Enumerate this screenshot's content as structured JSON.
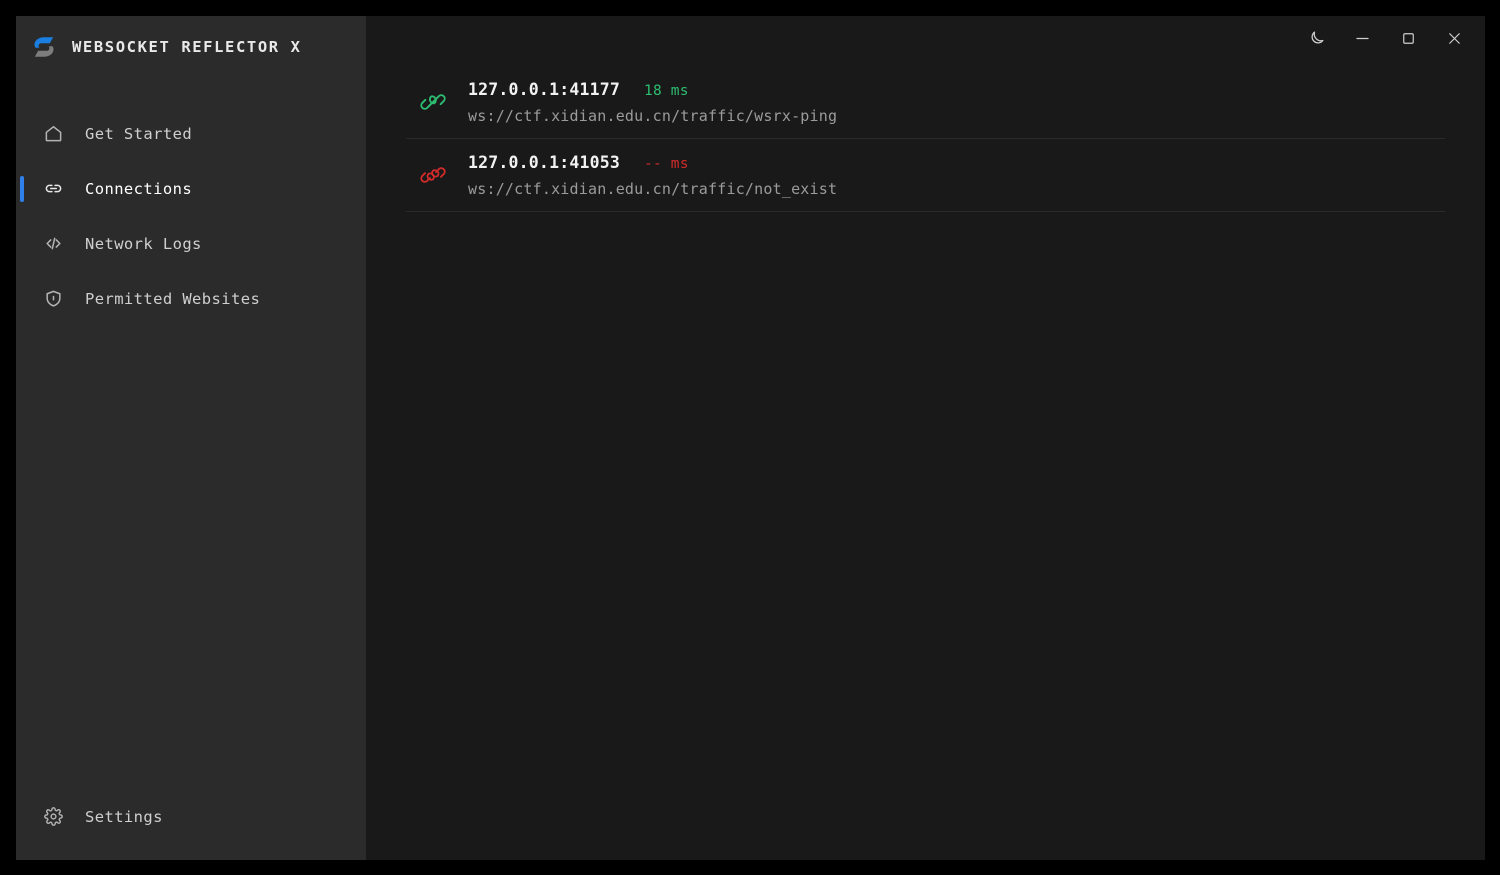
{
  "window": {
    "controls": [
      {
        "name": "theme-toggle",
        "icon": "moon-icon",
        "label": "Toggle dark mode"
      },
      {
        "name": "minimize",
        "icon": "minimize-icon",
        "label": "Minimize"
      },
      {
        "name": "maximize",
        "icon": "maximize-icon",
        "label": "Maximize"
      },
      {
        "name": "close",
        "icon": "close-icon",
        "label": "Close"
      }
    ]
  },
  "sidebar": {
    "brand": {
      "title": "WEBSOCKET REFLECTOR X",
      "logo_icon": "wsrx-hex-logo",
      "logo_colors": {
        "primary": "#1a7fe0",
        "secondary": "#7d7d7d"
      }
    },
    "items": [
      {
        "label": "Get Started",
        "icon": "home-icon",
        "active": false
      },
      {
        "label": "Connections",
        "icon": "link-icon",
        "active": true
      },
      {
        "label": "Network Logs",
        "icon": "code-icon",
        "active": false
      },
      {
        "label": "Permitted Websites",
        "icon": "shield-icon",
        "active": false
      }
    ],
    "bottom_items": [
      {
        "label": "Settings",
        "icon": "gear-icon",
        "active": false
      }
    ],
    "active_indicator_color": "#2f80ed"
  },
  "main": {
    "connections": [
      {
        "address": "127.0.0.1:41177",
        "latency": "18 ms",
        "status": "connected",
        "status_icon": "link-icon",
        "status_color": "#2dbd70",
        "url": "ws://ctf.xidian.edu.cn/traffic/wsrx-ping"
      },
      {
        "address": "127.0.0.1:41053",
        "latency": "-- ms",
        "status": "disconnected",
        "status_icon": "unlink-icon",
        "status_color": "#d22b2b",
        "url": "ws://ctf.xidian.edu.cn/traffic/not_exist"
      }
    ]
  }
}
